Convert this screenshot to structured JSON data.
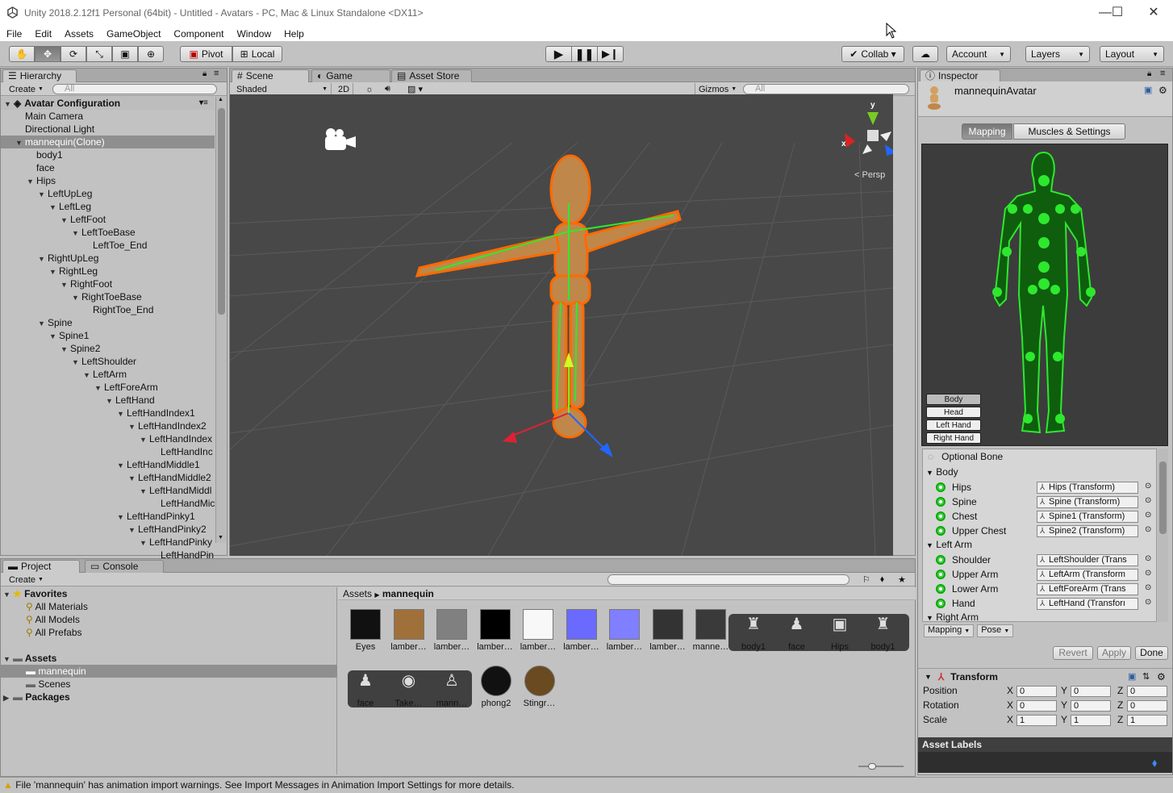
{
  "window": {
    "title": "Unity 2018.2.12f1 Personal (64bit) - Untitled - Avatars - PC, Mac & Linux Standalone <DX11>"
  },
  "menu": [
    "File",
    "Edit",
    "Assets",
    "GameObject",
    "Component",
    "Window",
    "Help"
  ],
  "toolbar": {
    "pivot": "Pivot",
    "local": "Local",
    "collab": "Collab ▾",
    "account": "Account",
    "layers": "Layers",
    "layout": "Layout"
  },
  "hierarchy": {
    "tab": "Hierarchy",
    "create": "Create",
    "search_placeholder": "All",
    "root": "Avatar Configuration",
    "rows": [
      {
        "label": "Main Camera",
        "indent": 0,
        "arrow": ""
      },
      {
        "label": "Directional Light",
        "indent": 0,
        "arrow": ""
      },
      {
        "label": "mannequin(Clone)",
        "indent": 0,
        "arrow": "▼",
        "selected": true
      },
      {
        "label": "body1",
        "indent": 1,
        "arrow": ""
      },
      {
        "label": "face",
        "indent": 1,
        "arrow": ""
      },
      {
        "label": "Hips",
        "indent": 1,
        "arrow": "▼"
      },
      {
        "label": "LeftUpLeg",
        "indent": 2,
        "arrow": "▼"
      },
      {
        "label": "LeftLeg",
        "indent": 3,
        "arrow": "▼"
      },
      {
        "label": "LeftFoot",
        "indent": 4,
        "arrow": "▼"
      },
      {
        "label": "LeftToeBase",
        "indent": 5,
        "arrow": "▼"
      },
      {
        "label": "LeftToe_End",
        "indent": 6,
        "arrow": ""
      },
      {
        "label": "RightUpLeg",
        "indent": 2,
        "arrow": "▼"
      },
      {
        "label": "RightLeg",
        "indent": 3,
        "arrow": "▼"
      },
      {
        "label": "RightFoot",
        "indent": 4,
        "arrow": "▼"
      },
      {
        "label": "RightToeBase",
        "indent": 5,
        "arrow": "▼"
      },
      {
        "label": "RightToe_End",
        "indent": 6,
        "arrow": ""
      },
      {
        "label": "Spine",
        "indent": 2,
        "arrow": "▼"
      },
      {
        "label": "Spine1",
        "indent": 3,
        "arrow": "▼"
      },
      {
        "label": "Spine2",
        "indent": 4,
        "arrow": "▼"
      },
      {
        "label": "LeftShoulder",
        "indent": 5,
        "arrow": "▼"
      },
      {
        "label": "LeftArm",
        "indent": 6,
        "arrow": "▼"
      },
      {
        "label": "LeftForeArm",
        "indent": 7,
        "arrow": "▼"
      },
      {
        "label": "LeftHand",
        "indent": 8,
        "arrow": "▼"
      },
      {
        "label": "LeftHandIndex1",
        "indent": 9,
        "arrow": "▼"
      },
      {
        "label": "LeftHandIndex2",
        "indent": 10,
        "arrow": "▼"
      },
      {
        "label": "LeftHandIndex",
        "indent": 11,
        "arrow": "▼"
      },
      {
        "label": "LeftHandInc",
        "indent": 12,
        "arrow": ""
      },
      {
        "label": "LeftHandMiddle1",
        "indent": 9,
        "arrow": "▼"
      },
      {
        "label": "LeftHandMiddle2",
        "indent": 10,
        "arrow": "▼"
      },
      {
        "label": "LeftHandMiddl",
        "indent": 11,
        "arrow": "▼"
      },
      {
        "label": "LeftHandMic",
        "indent": 12,
        "arrow": ""
      },
      {
        "label": "LeftHandPinky1",
        "indent": 9,
        "arrow": "▼"
      },
      {
        "label": "LeftHandPinky2",
        "indent": 10,
        "arrow": "▼"
      },
      {
        "label": "LeftHandPinky",
        "indent": 11,
        "arrow": "▼"
      },
      {
        "label": "LeftHandPin",
        "indent": 12,
        "arrow": ""
      }
    ]
  },
  "scene": {
    "tabs": [
      "Scene",
      "Game",
      "Asset Store"
    ],
    "shading": "Shaded",
    "mode2d": "2D",
    "gizmos": "Gizmos",
    "search_placeholder": "All",
    "persp": "Persp",
    "axes": {
      "x": "x",
      "y": "y",
      "z": "z"
    }
  },
  "project": {
    "tabs": [
      "Project",
      "Console"
    ],
    "create": "Create",
    "favorites": {
      "label": "Favorites",
      "items": [
        "All Materials",
        "All Models",
        "All Prefabs"
      ]
    },
    "assets": {
      "label": "Assets",
      "items": [
        "mannequin",
        "Scenes"
      ]
    },
    "packages": "Packages",
    "breadcrumb": [
      "Assets",
      "mannequin"
    ],
    "row1": [
      {
        "name": "Eyes",
        "color": "#111"
      },
      {
        "name": "lamber…",
        "color": "#a0703a"
      },
      {
        "name": "lamber…",
        "color": "#808080"
      },
      {
        "name": "lamber…",
        "color": "#000"
      },
      {
        "name": "lamber…",
        "color": "#f8f8f8"
      },
      {
        "name": "lamber…",
        "color": "#6a6aff"
      },
      {
        "name": "lamber…",
        "color": "#7f7fff"
      },
      {
        "name": "lamber…",
        "color": "#333"
      },
      {
        "name": "manne…",
        "color": "#3a3a3a"
      }
    ],
    "row1b": [
      "body1",
      "face",
      "Hips",
      "body1"
    ],
    "row2a": [
      "face",
      "Take…",
      "mann…"
    ],
    "row2b": [
      {
        "name": "phong2",
        "color": "#111"
      },
      {
        "name": "Stingr…",
        "color": "#6a4a20"
      }
    ]
  },
  "status": "File 'mannequin' has animation import warnings. See Import Messages in Animation Import Settings for more details.",
  "inspector": {
    "tab": "Inspector",
    "object": "mannequinAvatar",
    "mapping": "Mapping",
    "muscles": "Muscles & Settings",
    "body_buttons": [
      "Body",
      "Head",
      "Left Hand",
      "Right Hand"
    ],
    "optional": "Optional Bone",
    "groups": [
      {
        "label": "Body",
        "rows": [
          [
            "Hips",
            "Hips (Transform)"
          ],
          [
            "Spine",
            "Spine (Transform)"
          ],
          [
            "Chest",
            "Spine1 (Transform)"
          ],
          [
            "Upper Chest",
            "Spine2 (Transform)"
          ]
        ]
      },
      {
        "label": "Left Arm",
        "rows": [
          [
            "Shoulder",
            "LeftShoulder (Trans"
          ],
          [
            "Upper Arm",
            "LeftArm (Transform"
          ],
          [
            "Lower Arm",
            "LeftForeArm (Trans"
          ],
          [
            "Hand",
            "LeftHand (Transforı"
          ]
        ]
      },
      {
        "label": "Right Arm",
        "rows": []
      }
    ],
    "mapping_dd": "Mapping",
    "pose_dd": "Pose",
    "revert": "Revert",
    "apply": "Apply",
    "done": "Done",
    "transform": {
      "title": "Transform",
      "rows": [
        {
          "label": "Position",
          "x": "0",
          "y": "0",
          "z": "0"
        },
        {
          "label": "Rotation",
          "x": "0",
          "y": "0",
          "z": "0"
        },
        {
          "label": "Scale",
          "x": "1",
          "y": "1",
          "z": "1"
        }
      ]
    },
    "asset_labels": "Asset Labels"
  },
  "colors": {
    "accent_green": "#1fd11f",
    "selection": "#8f8f8f",
    "scene_bg": "#484848"
  }
}
